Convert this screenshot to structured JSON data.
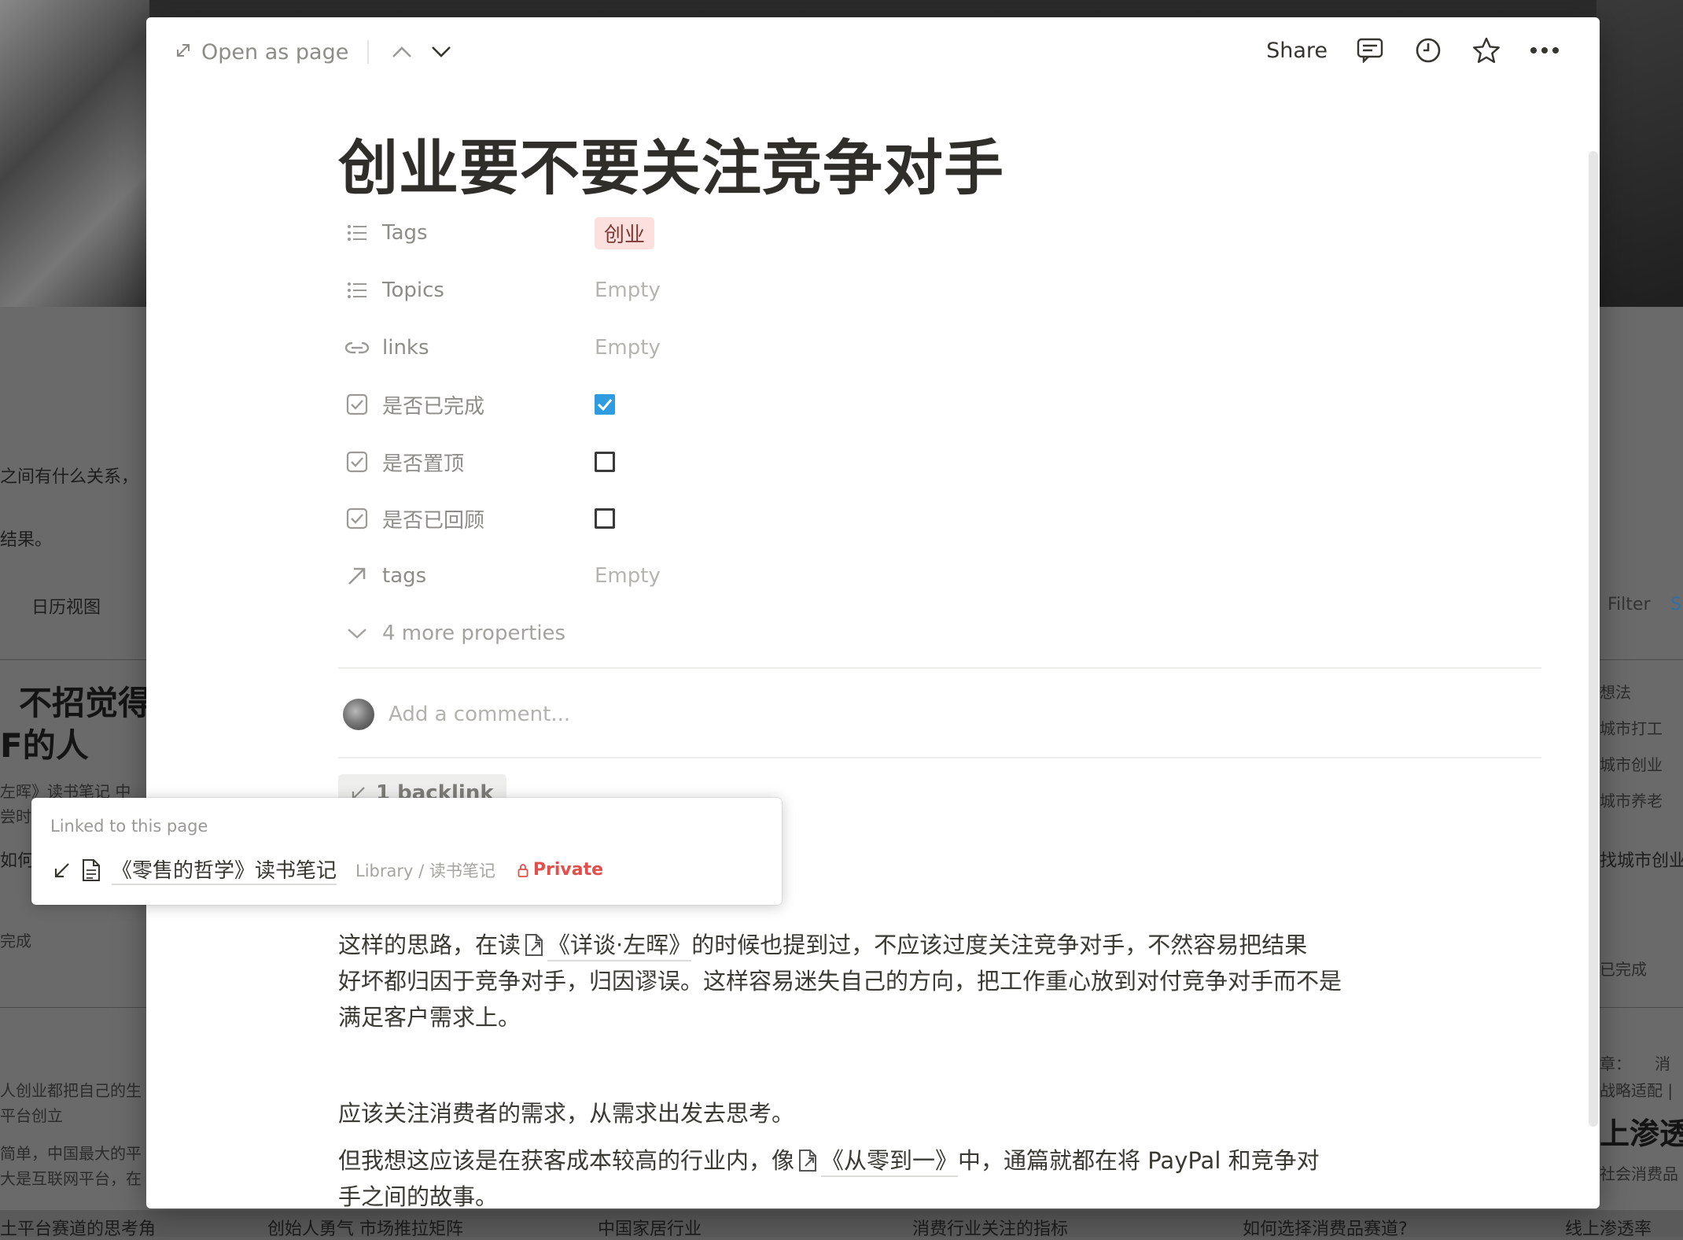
{
  "topbar": {
    "open_as_page": "Open as page",
    "share": "Share"
  },
  "page": {
    "title": "创业要不要关注竞争对手"
  },
  "properties": [
    {
      "label": "Tags",
      "icon": "list-icon",
      "value": "创业",
      "type": "tag"
    },
    {
      "label": "Topics",
      "icon": "list-icon",
      "value": "Empty",
      "type": "empty"
    },
    {
      "label": "links",
      "icon": "relation-icon",
      "value": "Empty",
      "type": "empty"
    },
    {
      "label": "是否已完成",
      "icon": "checkbox-icon",
      "checked": true,
      "type": "checkbox"
    },
    {
      "label": "是否置顶",
      "icon": "checkbox-icon",
      "checked": false,
      "type": "checkbox"
    },
    {
      "label": "是否已回顾",
      "icon": "checkbox-icon",
      "checked": false,
      "type": "checkbox"
    },
    {
      "label": "tags",
      "icon": "arrow-up-right-icon",
      "value": "Empty",
      "type": "empty"
    }
  ],
  "more_properties": "4 more properties",
  "comment": {
    "placeholder": "Add a comment..."
  },
  "backlinks": {
    "button_label": "1 backlink",
    "popover_heading": "Linked to this page",
    "item_title": "《零售的哲学》读书笔记",
    "item_path": "Library / 读书笔记",
    "item_private": "Private"
  },
  "body": {
    "p1_a": "这样的思路，在读",
    "p1_mention": "《详谈·左晖》",
    "p1_b": "的时候也提到过，不应该过度关注竞争对手，不然容易把结果",
    "p1_line2": "好坏都归因于竞争对手，归因谬误。这样容易迷失自己的方向，把工作重心放到对付竞争对手而不是",
    "p1_line3": "满足客户需求上。",
    "p2": "应该关注消费者的需求，从需求出发去思考。",
    "p3_a": "但我想这应该是在获客成本较高的行业内，像",
    "p3_mention": "《从零到一》",
    "p3_b": "中，通篇就都在将 PayPal 和竞争对",
    "p3_line2": "手之间的故事。"
  },
  "background": {
    "left_texts": [
      "之间有什么关系，",
      "结果。",
      "日历视图",
      "不招觉得",
      "F的人",
      "左晖》读书笔记 中",
      "尝时说",
      "如何",
      "完成",
      "人创业都把自己的生",
      "平台创立",
      "简单，中国最大的平",
      "大是互联网平台，在",
      "土平台赛道的思考角"
    ],
    "right_texts": [
      "Filter",
      "S",
      "想法",
      "城市打工",
      "城市创业",
      "城市养老",
      "找城市创业",
      "已完成",
      "章：",
      "消",
      "战略适配 |",
      "上渗透率",
      "社会消费品"
    ],
    "bottom_texts": [
      "创始人勇气 市场推拉矩阵",
      "中国家居行业",
      "消费行业关注的指标",
      "如何选择消费品赛道?",
      "线上渗透率"
    ]
  },
  "colors": {
    "accent_blue": "#2f9be0",
    "tag_bg": "#fde0dd",
    "private_red": "#e0504c"
  }
}
